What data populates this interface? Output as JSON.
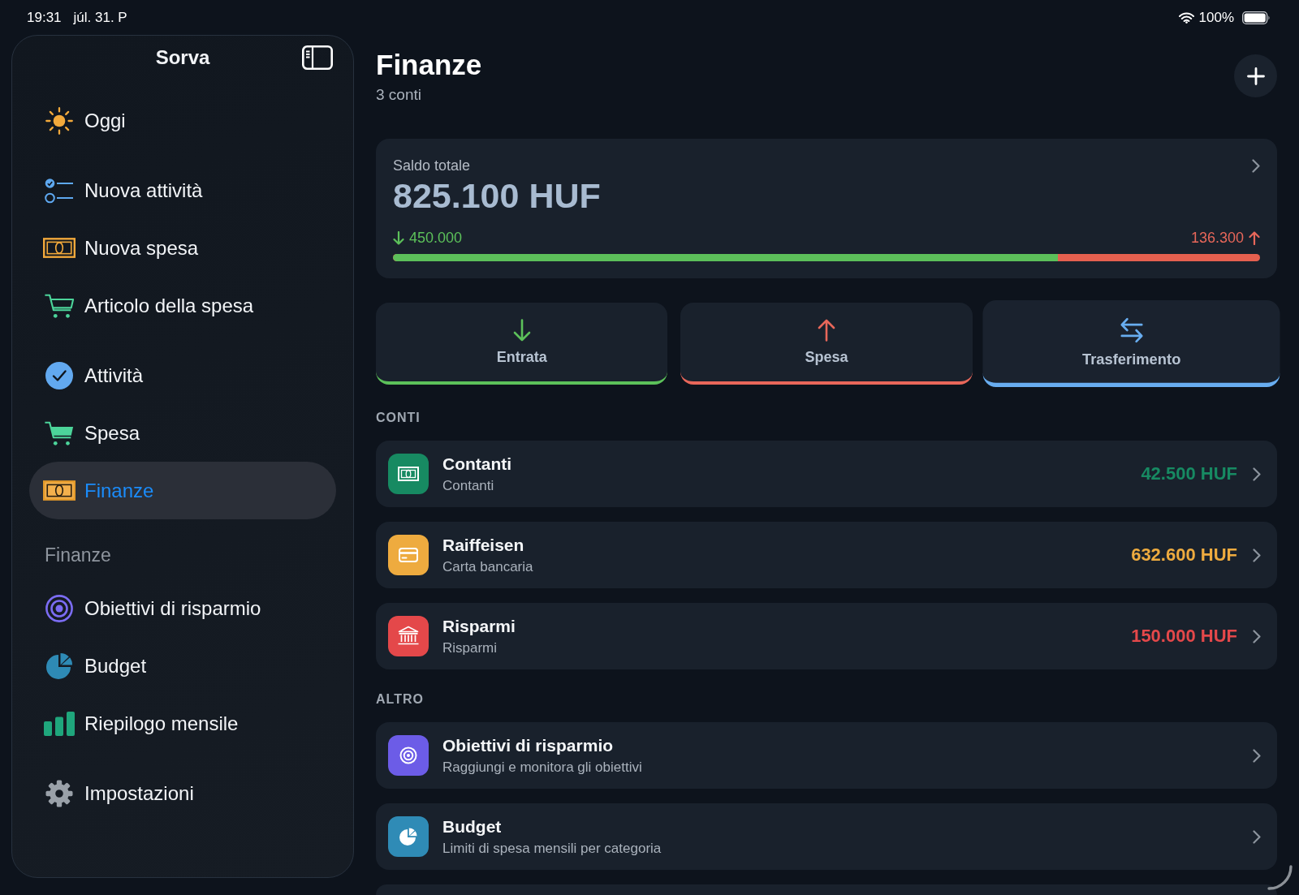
{
  "status_bar": {
    "time": "19:31",
    "date": "júl. 31. P",
    "battery": "100%"
  },
  "sidebar": {
    "title": "Sorva",
    "sections": [
      {
        "items": [
          {
            "label": "Oggi",
            "selected": false
          }
        ]
      },
      {
        "items": [
          {
            "label": "Nuova attività",
            "selected": false
          },
          {
            "label": "Nuova spesa",
            "selected": false
          },
          {
            "label": "Articolo della spesa",
            "selected": false
          }
        ]
      },
      {
        "items": [
          {
            "label": "Attività",
            "selected": false
          },
          {
            "label": "Spesa",
            "selected": false
          },
          {
            "label": "Finanze",
            "selected": true
          }
        ]
      },
      {
        "header": "Finanze",
        "items": [
          {
            "label": "Obiettivi di risparmio",
            "selected": false
          },
          {
            "label": "Budget",
            "selected": false
          },
          {
            "label": "Riepilogo mensile",
            "selected": false
          }
        ]
      },
      {
        "items": [
          {
            "label": "Impostazioni",
            "selected": false
          }
        ]
      }
    ]
  },
  "header": {
    "title": "Finanze",
    "subtitle": "3 conti"
  },
  "balance": {
    "label": "Saldo totale",
    "amount": "825.100 HUF",
    "income": "450.000",
    "expense": "136.300",
    "level": 0.767
  },
  "actions": [
    {
      "label": "Entrata",
      "color": "#5cc15a",
      "highlighted": false
    },
    {
      "label": "Spesa",
      "color": "#e8675a",
      "highlighted": false
    },
    {
      "label": "Trasferimento",
      "color": "#68adf0",
      "highlighted": true
    }
  ],
  "accounts": {
    "heading": "CONTI",
    "items": [
      {
        "name": "Contanti",
        "type": "Contanti",
        "balance": "42.500 HUF",
        "color": "#178a62"
      },
      {
        "name": "Raiffeisen",
        "type": "Carta bancaria",
        "balance": "632.600 HUF",
        "color": "#eeab3f"
      },
      {
        "name": "Risparmi",
        "type": "Risparmi",
        "balance": "150.000 HUF",
        "color": "#e4484a"
      }
    ]
  },
  "more": {
    "heading": "ALTRO",
    "items": [
      {
        "title": "Obiettivi di risparmio",
        "subtitle": "Raggiungi e monitora gli obiettivi",
        "color": "#6c5ce7"
      },
      {
        "title": "Budget",
        "subtitle": "Limiti di spesa mensili per categoria",
        "color": "#2f8bb6"
      }
    ]
  }
}
